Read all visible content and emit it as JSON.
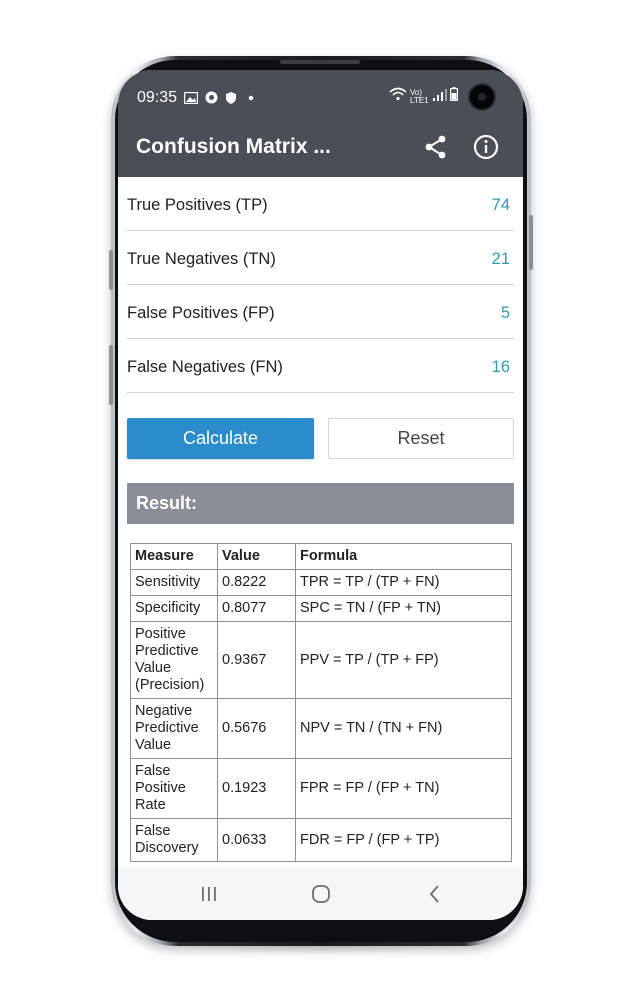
{
  "status_bar": {
    "time": "09:35",
    "network_label": "Vo) LTE1"
  },
  "app_bar": {
    "title": "Confusion Matrix ...",
    "icons": [
      "share-icon",
      "info-icon"
    ]
  },
  "inputs": [
    {
      "label": "True Positives (TP)",
      "value": "74"
    },
    {
      "label": "True Negatives (TN)",
      "value": "21"
    },
    {
      "label": "False Positives (FP)",
      "value": "5"
    },
    {
      "label": "False Negatives (FN)",
      "value": "16"
    }
  ],
  "buttons": {
    "calculate": "Calculate",
    "reset": "Reset"
  },
  "result": {
    "header": "Result:",
    "columns": [
      "Measure",
      "Value",
      "Formula"
    ],
    "rows": [
      {
        "measure": "Sensitivity",
        "value": "0.8222",
        "formula": "TPR = TP / (TP + FN)"
      },
      {
        "measure": "Specificity",
        "value": "0.8077",
        "formula": "SPC = TN / (FP + TN)"
      },
      {
        "measure": "Positive Predictive Value (Precision)",
        "value": "0.9367",
        "formula": "PPV = TP / (TP + FP)"
      },
      {
        "measure": "Negative Predictive Value",
        "value": "0.5676",
        "formula": "NPV = TN / (TN + FN)"
      },
      {
        "measure": "False Positive Rate",
        "value": "0.1923",
        "formula": "FPR = FP / (FP + TN)"
      },
      {
        "measure": "False Discovery",
        "value": "0.0633",
        "formula": "FDR = FP / (FP + TP)"
      }
    ]
  },
  "colors": {
    "app_bar": "#4a4e57",
    "accent_value": "#2a9db0",
    "calculate_button": "#2a8ccb",
    "result_header": "#8a8e99"
  },
  "nav_bar": {
    "icons": [
      "recent-apps-icon",
      "home-icon",
      "back-icon"
    ]
  }
}
